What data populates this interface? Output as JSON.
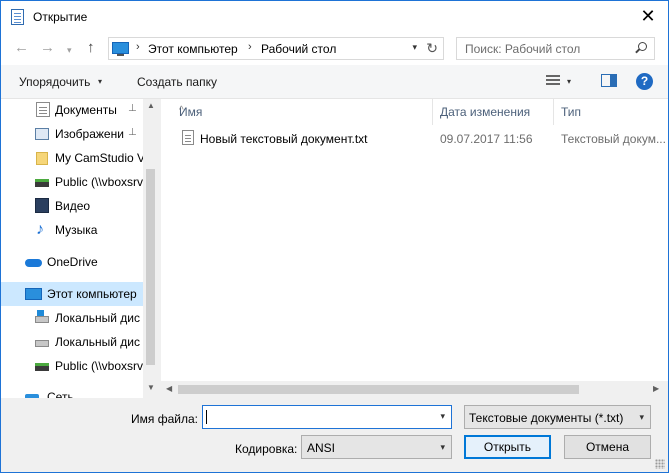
{
  "window": {
    "title": "Открытие",
    "close_glyph": "✕"
  },
  "navigation": {
    "back_glyph": "←",
    "forward_glyph": "→",
    "recent_glyph": "▾",
    "up_glyph": "↑",
    "address_parts": [
      "Этот компьютер",
      "Рабочий стол"
    ],
    "address_separator": "›",
    "address_dropdown_glyph": "▾",
    "refresh_glyph": "↻",
    "search_placeholder": "Поиск: Рабочий стол"
  },
  "toolbar": {
    "organize_label": "Упорядочить",
    "organize_arrow": "▾",
    "new_folder_label": "Создать папку",
    "view_arrow": "▾",
    "help_glyph": "?"
  },
  "sidebar": {
    "items": [
      {
        "label": "Документы",
        "icon": "documents-icon",
        "pinned": true
      },
      {
        "label": "Изображени",
        "icon": "pictures-icon",
        "pinned": true
      },
      {
        "label": "My CamStudio V",
        "icon": "folder-icon",
        "pinned": false
      },
      {
        "label": "Public (\\\\vboxsrv",
        "icon": "network-drive-icon",
        "pinned": false
      },
      {
        "label": "Видео",
        "icon": "video-icon",
        "pinned": false
      },
      {
        "label": "Музыка",
        "icon": "music-icon",
        "pinned": false
      },
      {
        "label": "OneDrive",
        "icon": "onedrive-icon",
        "pinned": false
      },
      {
        "label": "Этот компьютер",
        "icon": "computer-icon",
        "pinned": false,
        "selected": true
      },
      {
        "label": "Локальный дис",
        "icon": "windows-drive-icon",
        "pinned": false
      },
      {
        "label": "Локальный дис",
        "icon": "drive-icon",
        "pinned": false
      },
      {
        "label": "Public (\\\\vboxsrv",
        "icon": "network-drive-icon",
        "pinned": false
      },
      {
        "label": "Сеть",
        "icon": "network-icon",
        "pinned": false
      }
    ],
    "pin_glyph": "📌",
    "scroll_up_glyph": "▲",
    "scroll_down_glyph": "▼"
  },
  "filelist": {
    "columns": [
      "Имя",
      "Дата изменения",
      "Тип"
    ],
    "sort_glyph": "^",
    "rows": [
      {
        "name": "Новый текстовый документ.txt",
        "date": "09.07.2017 11:56",
        "type": "Текстовый докум..."
      }
    ],
    "scroll_left_glyph": "◀",
    "scroll_right_glyph": "▶"
  },
  "footer": {
    "filename_label": "Имя файла:",
    "filename_value": "",
    "filename_dropdown_glyph": "▾",
    "filter_value": "Текстовые документы (*.txt)",
    "filter_dropdown_glyph": "▾",
    "encoding_label": "Кодировка:",
    "encoding_value": "ANSI",
    "encoding_dropdown_glyph": "▾",
    "open_label": "Открыть",
    "cancel_label": "Отмена"
  },
  "colors": {
    "accent": "#1e73d6",
    "selection": "#cce8ff",
    "header_text": "#4c607a"
  }
}
